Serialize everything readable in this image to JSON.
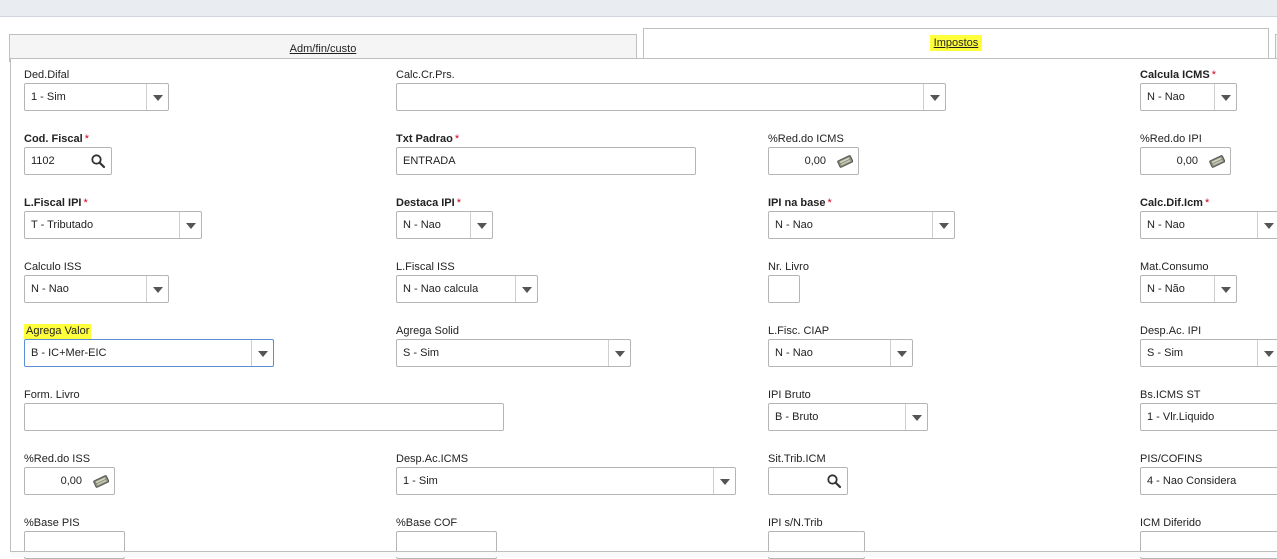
{
  "tabs": [
    {
      "label": "Adm/fin/custo"
    },
    {
      "label": "Impostos"
    }
  ],
  "fields": {
    "ded_difal": {
      "label": "Ded.Difal",
      "value": "1 - Sim"
    },
    "calc_cr_prs": {
      "label": "Calc.Cr.Prs.",
      "value": ""
    },
    "calcula_icms": {
      "label": "Calcula ICMS",
      "required": "*",
      "value": "N - Nao"
    },
    "cod_fiscal": {
      "label": "Cod. Fiscal",
      "required": "*",
      "value": "1102"
    },
    "txt_padrao": {
      "label": "Txt Padrao",
      "required": "*",
      "value": "ENTRADA"
    },
    "red_icms": {
      "label": "%Red.do ICMS",
      "value": "0,00"
    },
    "red_ipi": {
      "label": "%Red.do IPI",
      "value": "0,00"
    },
    "l_fiscal_ipi": {
      "label": "L.Fiscal IPI",
      "required": "*",
      "value": "T - Tributado"
    },
    "destaca_ipi": {
      "label": "Destaca IPI",
      "required": "*",
      "value": "N - Nao"
    },
    "ipi_na_base": {
      "label": "IPI na base",
      "required": "*",
      "value": "N - Nao"
    },
    "calc_dif_icm": {
      "label": "Calc.Dif.Icm",
      "required": "*",
      "value": "N - Nao"
    },
    "calculo_iss": {
      "label": "Calculo ISS",
      "value": "N - Nao"
    },
    "l_fiscal_iss": {
      "label": "L.Fiscal ISS",
      "value": "N - Nao calcula"
    },
    "nr_livro": {
      "label": "Nr. Livro",
      "value": ""
    },
    "mat_consumo": {
      "label": "Mat.Consumo",
      "value": "N - Não"
    },
    "agrega_valor": {
      "label": "Agrega Valor",
      "value": "B - IC+Mer-EIC"
    },
    "agrega_solid": {
      "label": "Agrega Solid",
      "value": "S - Sim"
    },
    "l_fisc_ciap": {
      "label": "L.Fisc. CIAP",
      "value": "N - Nao"
    },
    "desp_ac_ipi": {
      "label": "Desp.Ac. IPI",
      "value": "S - Sim"
    },
    "form_livro": {
      "label": "Form. Livro",
      "value": ""
    },
    "ipi_bruto": {
      "label": "IPI Bruto",
      "value": "B - Bruto"
    },
    "bs_icms_st": {
      "label": "Bs.ICMS ST",
      "value": "1 - Vlr.Liquido"
    },
    "red_iss": {
      "label": "%Red.do ISS",
      "value": "0,00"
    },
    "desp_ac_icms": {
      "label": "Desp.Ac.ICMS",
      "value": "1 - Sim"
    },
    "sit_trib_icm": {
      "label": "Sit.Trib.ICM",
      "value": ""
    },
    "pis_cofins": {
      "label": "PIS/COFINS",
      "value": "4 - Nao Considera"
    },
    "base_pis": {
      "label": "%Base PIS",
      "value": ""
    },
    "base_cof": {
      "label": "%Base COF",
      "value": ""
    },
    "ipi_s_n_trib": {
      "label": "IPI s/N.Trib",
      "value": ""
    },
    "icm_diferido": {
      "label": "ICM Diferido",
      "value": ""
    }
  },
  "icons": {
    "lookup": "magnifier-icon",
    "calculator": "calculator-icon",
    "dropdown": "chevron-down-icon"
  },
  "colors": {
    "highlight": "#ffff3b",
    "required": "#d0021b",
    "focus_border": "#5a8fd6"
  }
}
